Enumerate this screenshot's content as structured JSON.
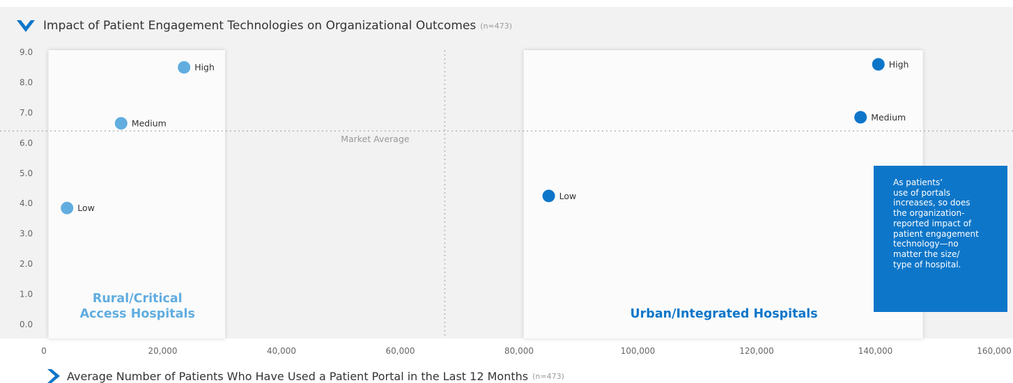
{
  "colors": {
    "rural": "#61ade0",
    "urban": "#0e76c9",
    "icon": "#0e76c9",
    "note_bg": "#0e76c9"
  },
  "icons": {
    "title": "chevron-down-icon",
    "x_axis": "chevron-right-icon"
  },
  "chart_data": {
    "type": "scatter",
    "title": "Impact of Patient Engagement Technologies on Organizational Outcomes",
    "title_note": "(n=473)",
    "xlabel": "Average Number of Patients Who Have Used a Patient Portal in the Last 12 Months",
    "xlabel_note": "(n=473)",
    "ylabel": "",
    "xlim": [
      0,
      160000
    ],
    "ylim": [
      0,
      9
    ],
    "x_ticks": [
      "0",
      "20,000",
      "40,000",
      "60,000",
      "80,000",
      "100,000",
      "120,000",
      "140,000",
      "160,000"
    ],
    "y_ticks": [
      "0.0",
      "1.0",
      "2.0",
      "3.0",
      "4.0",
      "5.0",
      "6.0",
      "7.0",
      "8.0",
      "9.0"
    ],
    "grid": false,
    "reference_lines": [
      {
        "axis": "y",
        "value": 6.4,
        "label": "Market Average"
      },
      {
        "axis": "x",
        "value": 67500,
        "label": ""
      }
    ],
    "groups": [
      {
        "label": "Rural/Critical Access Hospitals",
        "label_lines": [
          "Rural/Critical",
          "Access Hospitals"
        ],
        "x_range": [
          1000,
          30500
        ]
      },
      {
        "label": "Urban/Integrated Hospitals",
        "label_lines": [
          "Urban/Integrated Hospitals"
        ],
        "x_range": [
          81000,
          148000
        ]
      }
    ],
    "series": [
      {
        "name": "Rural/Critical Access Hospitals",
        "points": [
          {
            "label": "Low",
            "x": 3900,
            "y": 3.85
          },
          {
            "label": "Medium",
            "x": 13000,
            "y": 6.65
          },
          {
            "label": "High",
            "x": 23600,
            "y": 8.5
          }
        ]
      },
      {
        "name": "Urban/Integrated Hospitals",
        "points": [
          {
            "label": "Low",
            "x": 85000,
            "y": 4.25
          },
          {
            "label": "Medium",
            "x": 137500,
            "y": 6.85
          },
          {
            "label": "High",
            "x": 140500,
            "y": 8.6
          }
        ]
      }
    ],
    "annotation": "As patients’ use of portals increases, so does the organization-reported impact of patient engagement technology—no matter the size/type of hospital."
  },
  "note": {
    "lines": [
      "As patients’",
      "use of portals",
      "increases, so does",
      "the organization-",
      "reported impact of",
      "patient engagement",
      "technology—no",
      "matter the size/",
      "type of hospital."
    ]
  }
}
